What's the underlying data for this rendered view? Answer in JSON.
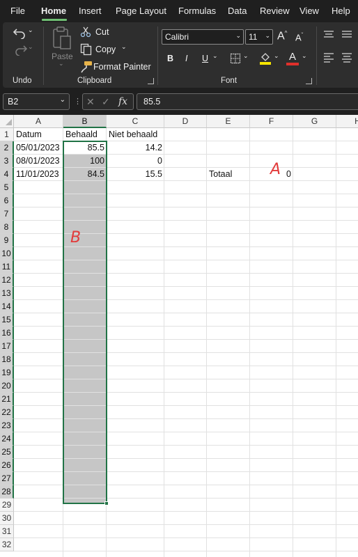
{
  "menu": {
    "items": [
      "File",
      "Home",
      "Insert",
      "Page Layout",
      "Formulas",
      "Data",
      "Review",
      "View",
      "Help"
    ],
    "active": "Home"
  },
  "ribbon": {
    "undo_group": {
      "label": "Undo"
    },
    "clipboard": {
      "label": "Clipboard",
      "paste": "Paste",
      "cut": "Cut",
      "copy": "Copy",
      "format_painter": "Format Painter"
    },
    "font": {
      "label": "Font",
      "font_name": "Calibri",
      "font_size": "11",
      "bold": "B",
      "italic": "I",
      "underline": "U",
      "grow": "A",
      "shrink": "A",
      "font_color_letter": "A",
      "highlight_color": "#f5e400",
      "font_color": "#e0302b"
    }
  },
  "formula_bar": {
    "name_box": "B2",
    "fx": "fx",
    "formula": "85.5"
  },
  "grid": {
    "columns": [
      "A",
      "B",
      "C",
      "D",
      "E",
      "F",
      "G",
      "H"
    ],
    "selected_column": "B",
    "rows": [
      "1",
      "2",
      "3",
      "4",
      "5",
      "6",
      "7",
      "8",
      "9",
      "10",
      "11",
      "12",
      "13",
      "14",
      "15",
      "16",
      "17",
      "18",
      "19",
      "20",
      "21",
      "22",
      "23",
      "24",
      "25",
      "26",
      "27",
      "28",
      "29",
      "30",
      "31",
      "32"
    ],
    "selected_rows_from": 2,
    "selected_rows_to": 28,
    "header_row": {
      "a": "Datum",
      "b": "Behaald",
      "c": "Niet behaald"
    },
    "data_rows": [
      {
        "a": "05/01/2023",
        "b": "85.5",
        "c": "14.2"
      },
      {
        "a": "08/01/2023",
        "b": "100",
        "c": "0"
      },
      {
        "a": "11/01/2023",
        "b": "84.5",
        "c": "15.5"
      }
    ],
    "totaal_label": "Totaal",
    "totaal_value": "0"
  },
  "annotations": {
    "a": "A",
    "b": "B"
  },
  "colors": {
    "accent_green": "#217346",
    "annotation_red": "#e23b3b",
    "ribbon_bg": "#2e2e2e"
  }
}
